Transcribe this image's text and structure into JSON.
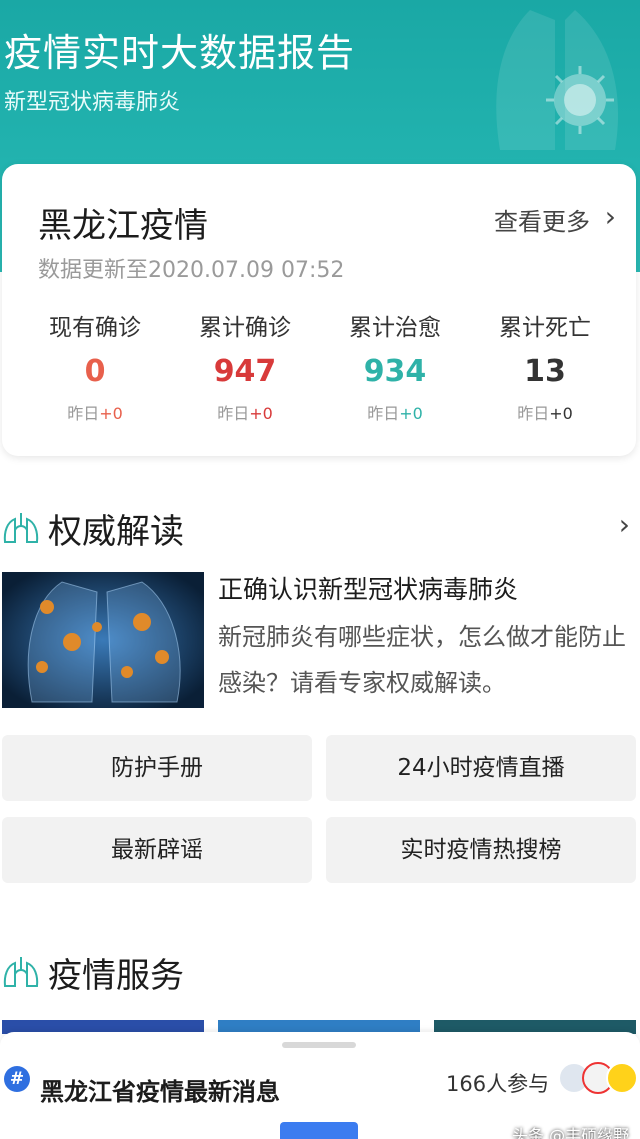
{
  "header": {
    "title": "疫情实时大数据报告",
    "subtitle": "新型冠状病毒肺炎"
  },
  "stats_card": {
    "region": "黑龙江疫情",
    "more_label": "查看更多",
    "updated": "数据更新至2020.07.09 07:52",
    "items": [
      {
        "label": "现有确诊",
        "value": "0",
        "delta_prefix": "昨日",
        "delta": "+0",
        "color": "#e8604c"
      },
      {
        "label": "累计确诊",
        "value": "947",
        "delta_prefix": "昨日",
        "delta": "+0",
        "color": "#d83a3a"
      },
      {
        "label": "累计治愈",
        "value": "934",
        "delta_prefix": "昨日",
        "delta": "+0",
        "color": "#2fb2a8"
      },
      {
        "label": "累计死亡",
        "value": "13",
        "delta_prefix": "昨日",
        "delta": "+0",
        "color": "#333333"
      }
    ]
  },
  "authority": {
    "title": "权威解读",
    "article_title": "正确认识新型冠状病毒肺炎",
    "article_desc": "新冠肺炎有哪些症状，怎么做才能防止感染？请看专家权威解读。"
  },
  "buttons": {
    "protection": "防护手册",
    "live": "24小时疫情直播",
    "rumors": "最新辟谣",
    "hot_search": "实时疫情热搜榜"
  },
  "services": {
    "title": "疫情服务"
  },
  "topic_sheet": {
    "hash_icon": "#",
    "title": "黑龙江省疫情最新消息",
    "participants": "166人参与"
  },
  "watermark": "头条 @丰硕缘野",
  "colors": {
    "banner": "#22b3af",
    "accent_blue": "#3b7cf0"
  }
}
